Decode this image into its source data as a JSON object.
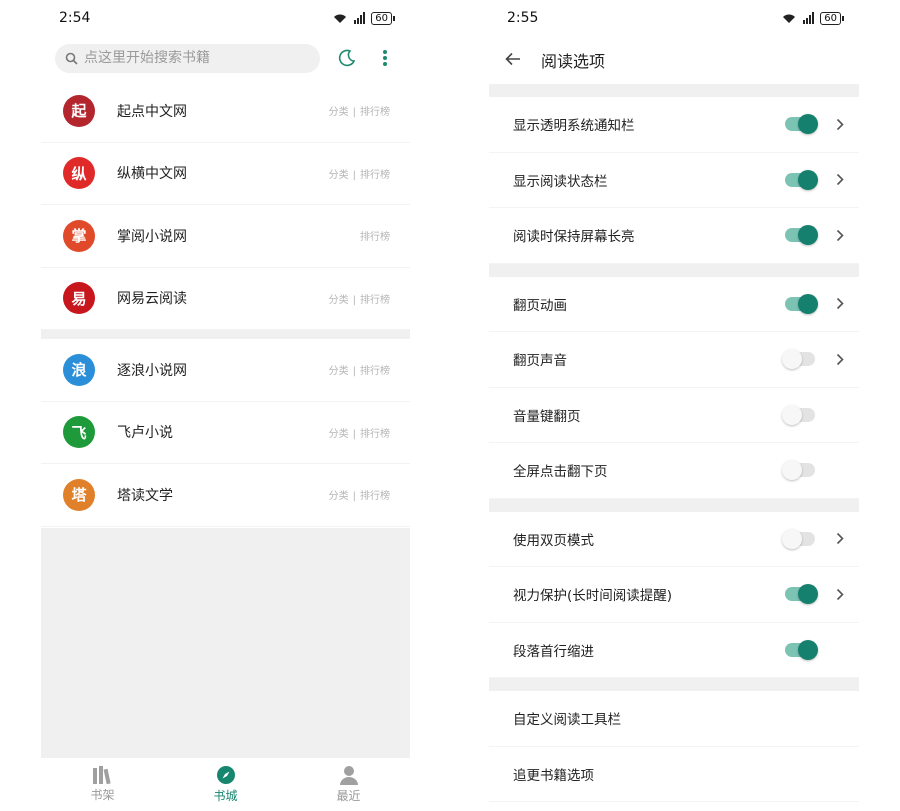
{
  "colors": {
    "accent": "#15806d",
    "accent_light": "#7cc3b4",
    "bg_gray": "#f0f0f0"
  },
  "left": {
    "status": {
      "time": "2:54",
      "battery": "60"
    },
    "search": {
      "placeholder": "点这里开始搜索书籍"
    },
    "sites": [
      {
        "name": "起点中文网",
        "logo_char": "起",
        "logo_color": "#b3262d",
        "links": [
          "分类",
          "排行榜"
        ]
      },
      {
        "name": "纵横中文网",
        "logo_char": "纵",
        "logo_color": "#e02a2a",
        "links": [
          "分类",
          "排行榜"
        ]
      },
      {
        "name": "掌阅小说网",
        "logo_char": "掌",
        "logo_color": "#e04a2a",
        "links": [
          "排行榜"
        ]
      },
      {
        "name": "网易云阅读",
        "logo_char": "易",
        "logo_color": "#c8161d",
        "links": [
          "分类",
          "排行榜"
        ]
      },
      {
        "name": "逐浪小说网",
        "logo_char": "浪",
        "logo_color": "#2a8fd8",
        "links": [
          "分类",
          "排行榜"
        ]
      },
      {
        "name": "飞卢小说",
        "logo_char": "飞",
        "logo_color": "#1e9a3a",
        "links": [
          "分类",
          "排行榜"
        ]
      },
      {
        "name": "塔读文学",
        "logo_char": "塔",
        "logo_color": "#e0802a",
        "links": [
          "分类",
          "排行榜"
        ]
      }
    ],
    "tabs": [
      {
        "label": "书架",
        "icon": "bookshelf-icon",
        "active": false
      },
      {
        "label": "书城",
        "icon": "compass-icon",
        "active": true
      },
      {
        "label": "最近",
        "icon": "person-icon",
        "active": false
      }
    ]
  },
  "right": {
    "status": {
      "time": "2:55",
      "battery": "60"
    },
    "title": "阅读选项",
    "groups": [
      [
        {
          "label": "显示透明系统通知栏",
          "on": true,
          "chevron": true
        },
        {
          "label": "显示阅读状态栏",
          "on": true,
          "chevron": true
        },
        {
          "label": "阅读时保持屏幕长亮",
          "on": true,
          "chevron": true
        }
      ],
      [
        {
          "label": "翻页动画",
          "on": true,
          "chevron": true
        },
        {
          "label": "翻页声音",
          "on": false,
          "chevron": true
        },
        {
          "label": "音量键翻页",
          "on": false,
          "chevron": false
        },
        {
          "label": "全屏点击翻下页",
          "on": false,
          "chevron": false
        }
      ],
      [
        {
          "label": "使用双页模式",
          "on": false,
          "chevron": true
        },
        {
          "label": "视力保护(长时间阅读提醒)",
          "on": true,
          "chevron": true
        },
        {
          "label": "段落首行缩进",
          "on": true,
          "chevron": false
        }
      ],
      [
        {
          "label": "自定义阅读工具栏",
          "switch": false
        },
        {
          "label": "追更书籍选项",
          "switch": false
        }
      ]
    ]
  }
}
